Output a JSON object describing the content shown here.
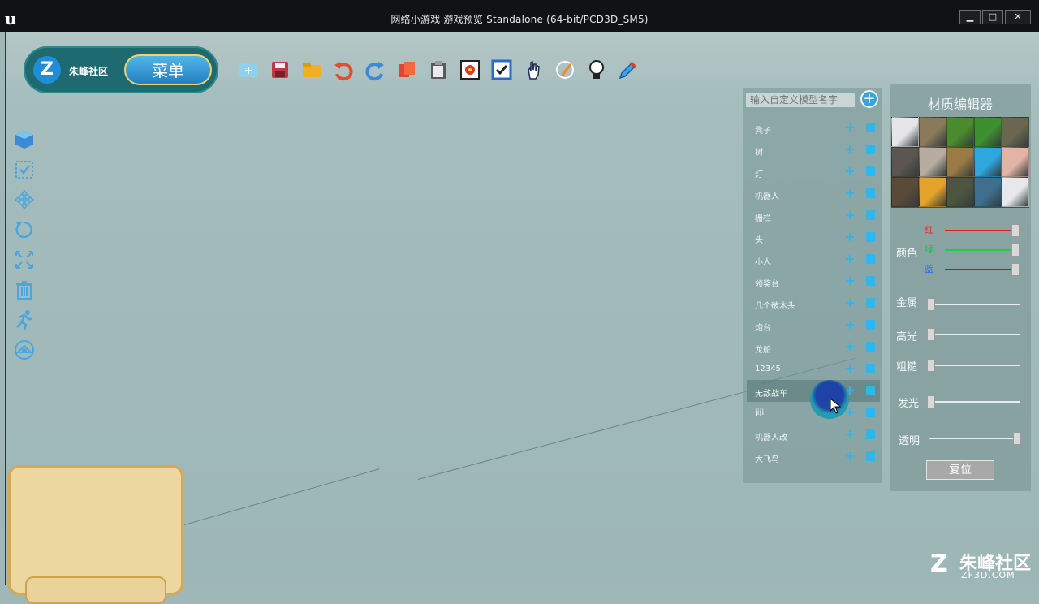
{
  "window": {
    "title": "网络小游戏 游戏预览 Standalone (64-bit/PCD3D_SM5)",
    "buttons": {
      "minimize": "▁",
      "maximize": "□",
      "close": "✕"
    }
  },
  "brand": {
    "name": "朱峰社区",
    "menu_label": "菜单"
  },
  "toolbar": {
    "icons": [
      "add-folder-icon",
      "save-icon",
      "open-folder-icon",
      "undo-icon",
      "redo-icon",
      "copy-icon",
      "paste-icon",
      "target-icon",
      "checkbox-icon",
      "hand-icon",
      "paint-icon",
      "light-bulb-icon",
      "eyedropper-icon"
    ]
  },
  "left_tools": {
    "icons": [
      "cube-icon",
      "select-icon",
      "move-icon",
      "rotate-icon",
      "scale-icon",
      "trash-icon",
      "run-icon",
      "camera-icon"
    ]
  },
  "model_panel": {
    "search_placeholder": "输入自定义模型名字",
    "add_symbol": "+",
    "items": [
      {
        "name": "凳子",
        "active": false
      },
      {
        "name": "树",
        "active": false
      },
      {
        "name": "灯",
        "active": false
      },
      {
        "name": "机器人",
        "active": false
      },
      {
        "name": "栅栏",
        "active": false
      },
      {
        "name": "头",
        "active": false
      },
      {
        "name": "小人",
        "active": false
      },
      {
        "name": "领奖台",
        "active": false
      },
      {
        "name": "几个破木头",
        "active": false
      },
      {
        "name": "炮台",
        "active": false
      },
      {
        "name": "龙船",
        "active": false
      },
      {
        "name": "12345",
        "active": false
      },
      {
        "name": "无敌战车",
        "active": true
      },
      {
        "name": "jiji",
        "active": false
      },
      {
        "name": "机器人改",
        "active": false
      },
      {
        "name": "大飞鸟",
        "active": false
      }
    ]
  },
  "material_editor": {
    "title": "材质编辑器",
    "swatch_colors": [
      "#e6e6ea",
      "#8a7a5a",
      "#4b8a2d",
      "#3d8f30",
      "#6b6650",
      "#5c5650",
      "#b8aba0",
      "#9a7a45",
      "#2ea7df",
      "#e2b4a6",
      "#5a4a38",
      "#e4a32a",
      "#4d5540",
      "#3e6f8e",
      "#e8e8ec"
    ],
    "color_label": "颜色",
    "red_label": "红",
    "green_label": "绿",
    "blue_label": "蓝",
    "red_value": 1.0,
    "green_value": 1.0,
    "blue_value": 1.0,
    "metal_label": "金属",
    "metal_value": 0.0,
    "specular_label": "高光",
    "specular_value": 0.0,
    "roughness_label": "粗糙",
    "roughness_value": 0.0,
    "emissive_label": "发光",
    "emissive_value": 0.0,
    "opacity_label": "透明",
    "opacity_value": 1.0,
    "reset_label": "复位"
  },
  "watermark": {
    "brand": "朱峰社区",
    "url": "ZF3D.COM",
    "mark": "Z"
  },
  "colors": {
    "accent": "#2fb6ee",
    "toolbar_gold": "#f4d26a",
    "panel_bg": "#1f6a70"
  }
}
